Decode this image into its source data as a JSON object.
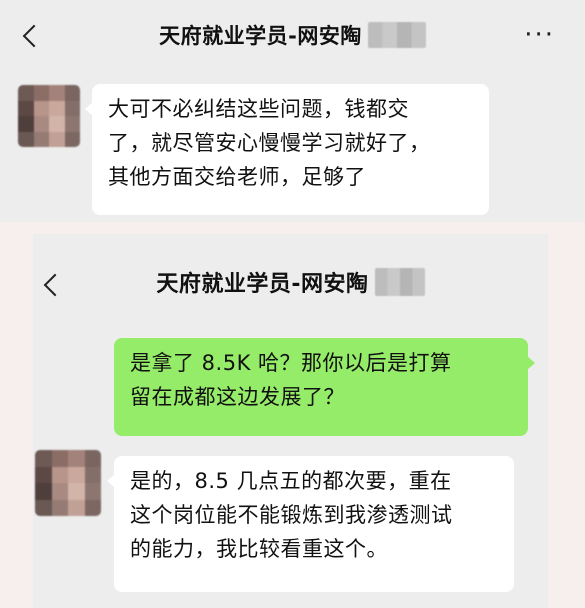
{
  "chat1": {
    "title": "天府就业学员-网安陶",
    "more_icon_text": "···",
    "messages": [
      {
        "direction": "incoming",
        "lines": [
          "大可不必纠结这些问题，钱都交",
          "了，就尽管安心慢慢学习就好了，",
          "其他方面交给老师，足够了"
        ]
      }
    ]
  },
  "chat2": {
    "title": "天府就业学员-网安陶",
    "messages": [
      {
        "direction": "outgoing",
        "lines": [
          "是拿了 8.5K 哈？那你以后是打算",
          "留在成都这边发展了？"
        ]
      },
      {
        "direction": "incoming",
        "lines": [
          "是的，8.5 几点五的都次要，重在",
          "这个岗位能不能锻炼到我渗透测试",
          "的能力，我比较看重这个。"
        ]
      }
    ]
  },
  "colors": {
    "chat_background": "#ededed",
    "incoming_bubble": "#ffffff",
    "outgoing_bubble": "#95ec69",
    "page_background": "#f7efed"
  },
  "icons": [
    "back-arrow-icon",
    "more-options-icon",
    "contact-avatar"
  ]
}
